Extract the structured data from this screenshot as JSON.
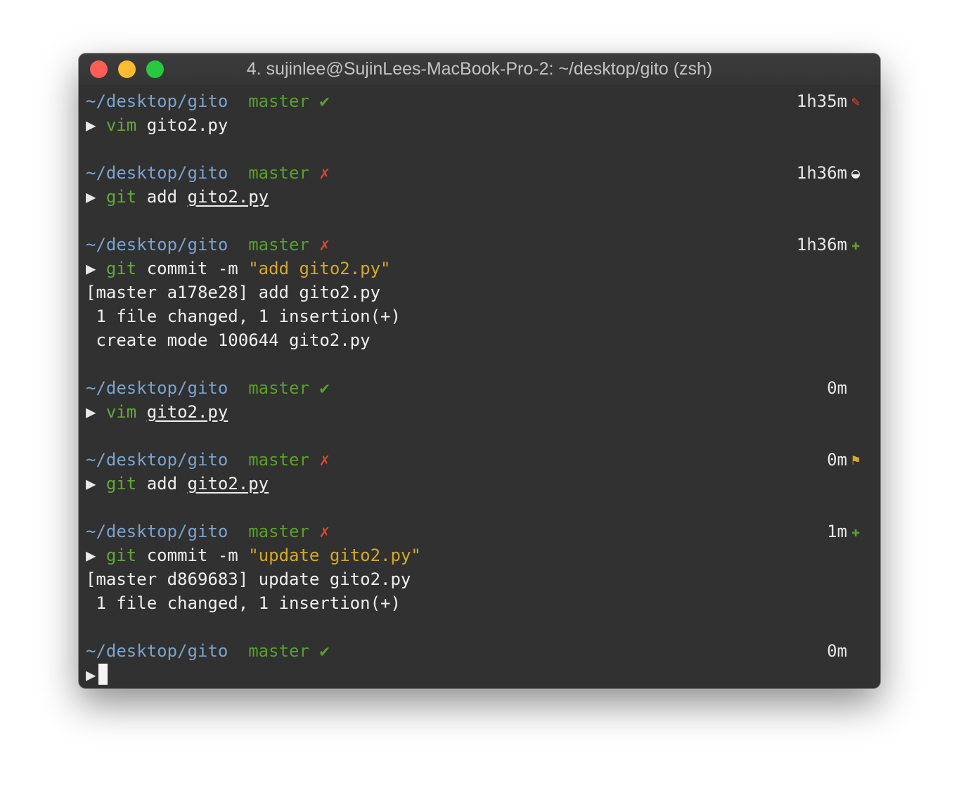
{
  "window": {
    "title": "4. sujinlee@SujinLees-MacBook-Pro-2: ~/desktop/gito (zsh)",
    "traffic_lights": [
      {
        "name": "close",
        "color": "#fd5f57"
      },
      {
        "name": "minimize",
        "color": "#febc2e"
      },
      {
        "name": "zoom",
        "color": "#28c840"
      }
    ]
  },
  "blocks": [
    {
      "path": "~/desktop/gito",
      "branch": "master",
      "state": "✔",
      "state_type": "clean",
      "elapsed": "1h35m",
      "icon": "no-pencil-icon",
      "icon_glyph": "✎",
      "icon_color": "#e0462f",
      "prompt": "▶",
      "cmd": "vim",
      "args": [
        {
          "text": " gito2.py",
          "style": "plain"
        }
      ],
      "output": []
    },
    {
      "path": "~/desktop/gito",
      "branch": "master",
      "state": "✗",
      "state_type": "dirty",
      "elapsed": "1h36m",
      "icon": "half-circle-icon",
      "icon_glyph": "◒",
      "icon_color": "#f0f0f0",
      "prompt": "▶",
      "cmd": "git",
      "args": [
        {
          "text": " add ",
          "style": "plain"
        },
        {
          "text": "gito2.py",
          "style": "underline"
        }
      ],
      "output": []
    },
    {
      "path": "~/desktop/gito",
      "branch": "master",
      "state": "✗",
      "state_type": "dirty",
      "elapsed": "1h36m",
      "icon": "plus-icon",
      "icon_glyph": "✚",
      "icon_color": "#59a02a",
      "prompt": "▶",
      "cmd": "git",
      "args": [
        {
          "text": " commit -m ",
          "style": "plain"
        },
        {
          "text": "\"add gito2.py\"",
          "style": "string"
        }
      ],
      "output": [
        "[master a178e28] add gito2.py",
        " 1 file changed, 1 insertion(+)",
        " create mode 100644 gito2.py"
      ]
    },
    {
      "path": "~/desktop/gito",
      "branch": "master",
      "state": "✔",
      "state_type": "clean",
      "elapsed": "0m",
      "icon": "",
      "icon_glyph": "",
      "icon_color": "#f0f0f0",
      "prompt": "▶",
      "cmd": "vim",
      "args": [
        {
          "text": " ",
          "style": "plain"
        },
        {
          "text": "gito2.py",
          "style": "underline"
        }
      ],
      "output": []
    },
    {
      "path": "~/desktop/gito",
      "branch": "master",
      "state": "✗",
      "state_type": "dirty",
      "elapsed": "0m",
      "icon": "flag-icon",
      "icon_glyph": "⚑",
      "icon_color": "#d6a82a",
      "prompt": "▶",
      "cmd": "git",
      "args": [
        {
          "text": " add ",
          "style": "plain"
        },
        {
          "text": "gito2.py",
          "style": "underline"
        }
      ],
      "output": []
    },
    {
      "path": "~/desktop/gito",
      "branch": "master",
      "state": "✗",
      "state_type": "dirty",
      "elapsed": "1m",
      "icon": "plus-icon",
      "icon_glyph": "✚",
      "icon_color": "#59a02a",
      "prompt": "▶",
      "cmd": "git",
      "args": [
        {
          "text": " commit -m ",
          "style": "plain"
        },
        {
          "text": "\"update gito2.py\"",
          "style": "string"
        }
      ],
      "output": [
        "[master d869683] update gito2.py",
        " 1 file changed, 1 insertion(+)"
      ]
    },
    {
      "path": "~/desktop/gito",
      "branch": "master",
      "state": "✔",
      "state_type": "clean",
      "elapsed": "0m",
      "icon": "",
      "icon_glyph": "",
      "icon_color": "#f0f0f0",
      "prompt": "▶",
      "cmd": "",
      "args": [],
      "output": [],
      "cursor": true
    }
  ]
}
